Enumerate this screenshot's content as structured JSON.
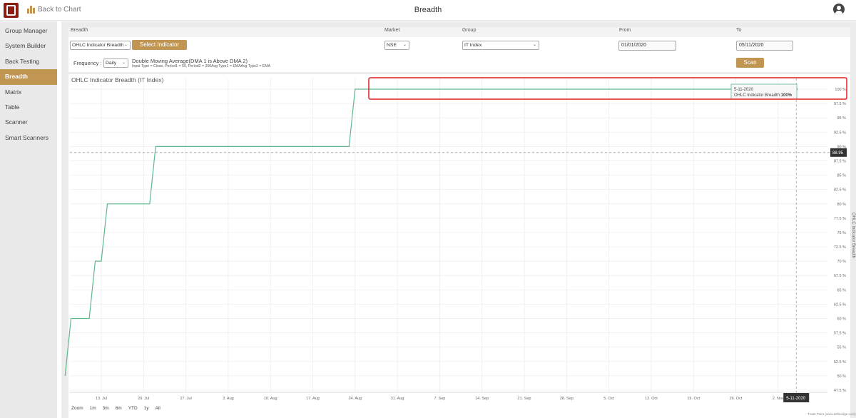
{
  "header": {
    "back_label": "Back to Chart",
    "page_title": "Breadth"
  },
  "sidebar": {
    "items": [
      {
        "label": "Group Manager"
      },
      {
        "label": "System Builder"
      },
      {
        "label": "Back Testing"
      },
      {
        "label": "Breadth",
        "active": true
      },
      {
        "label": "Matrix"
      },
      {
        "label": "Table"
      },
      {
        "label": "Scanner"
      },
      {
        "label": "Smart Scanners"
      }
    ]
  },
  "form": {
    "headers": {
      "breadth": "Breadth",
      "market": "Market",
      "group": "Group",
      "from": "From",
      "to": "To"
    },
    "breadth_value": "OHLC Indicator Breadth",
    "select_indicator_label": "Select Indicator",
    "market_value": "NSE",
    "group_value": "IT Index",
    "from_value": "01/01/2020",
    "to_value": "05/11/2020",
    "frequency_label": "Frequency :",
    "frequency_value": "Daily",
    "indicator_name": "Double Moving Average(DMA 1 is Above DMA 2)",
    "indicator_params": "Input Type = Close, Period1 = 50, Period2 = 200Avg Type1 = EMAAvg Type2 = EMA",
    "scan_label": "Scan"
  },
  "chart_data": {
    "type": "line",
    "title": "OHLC Indicator Breadth (IT Index)",
    "ylabel": "OHLC Indicator Breadth",
    "ylim": [
      47.5,
      100
    ],
    "yticks": [
      "100 %",
      "97.5 %",
      "95 %",
      "92.5 %",
      "90 %",
      "87.5 %",
      "85 %",
      "82.5 %",
      "80 %",
      "77.5 %",
      "75 %",
      "72.5 %",
      "70 %",
      "67.5 %",
      "65 %",
      "62.5 %",
      "60 %",
      "57.5 %",
      "55 %",
      "52.5 %",
      "50 %",
      "47.5 %"
    ],
    "xticks": [
      "13. Jul",
      "20. Jul",
      "27. Jul",
      "3. Aug",
      "10. Aug",
      "17. Aug",
      "24. Aug",
      "31. Aug",
      "7. Sep",
      "14. Sep",
      "21. Sep",
      "28. Sep",
      "5. Oct",
      "12. Oct",
      "19. Oct",
      "26. Oct",
      "2. Nov"
    ],
    "series": [
      {
        "name": "OHLC Indicator Breadth",
        "color": "#5fb88d",
        "points": [
          [
            "2020-07-07",
            50
          ],
          [
            "2020-07-08",
            60
          ],
          [
            "2020-07-11",
            60
          ],
          [
            "2020-07-12",
            70
          ],
          [
            "2020-07-13",
            70
          ],
          [
            "2020-07-14",
            80
          ],
          [
            "2020-07-21",
            80
          ],
          [
            "2020-07-22",
            90
          ],
          [
            "2020-08-23",
            90
          ],
          [
            "2020-08-24",
            100
          ],
          [
            "2020-11-05",
            100
          ]
        ]
      }
    ],
    "crosshair_value": "88.95",
    "crosshair_x_label": "5-11-2020",
    "tooltip": {
      "date": "5-11-2020",
      "series": "OHLC Indicator Breadth:",
      "value": "100%"
    },
    "grid": true
  },
  "zoom": {
    "label": "Zoom",
    "options": [
      "1m",
      "3m",
      "6m",
      "YTD",
      "1y",
      "All"
    ]
  },
  "credit": "Trade Point (www.definedge.com)",
  "colors": {
    "accent": "#c19552",
    "brand": "#8d1d12",
    "line": "#5fb88d",
    "highlight": "#e01f24"
  }
}
